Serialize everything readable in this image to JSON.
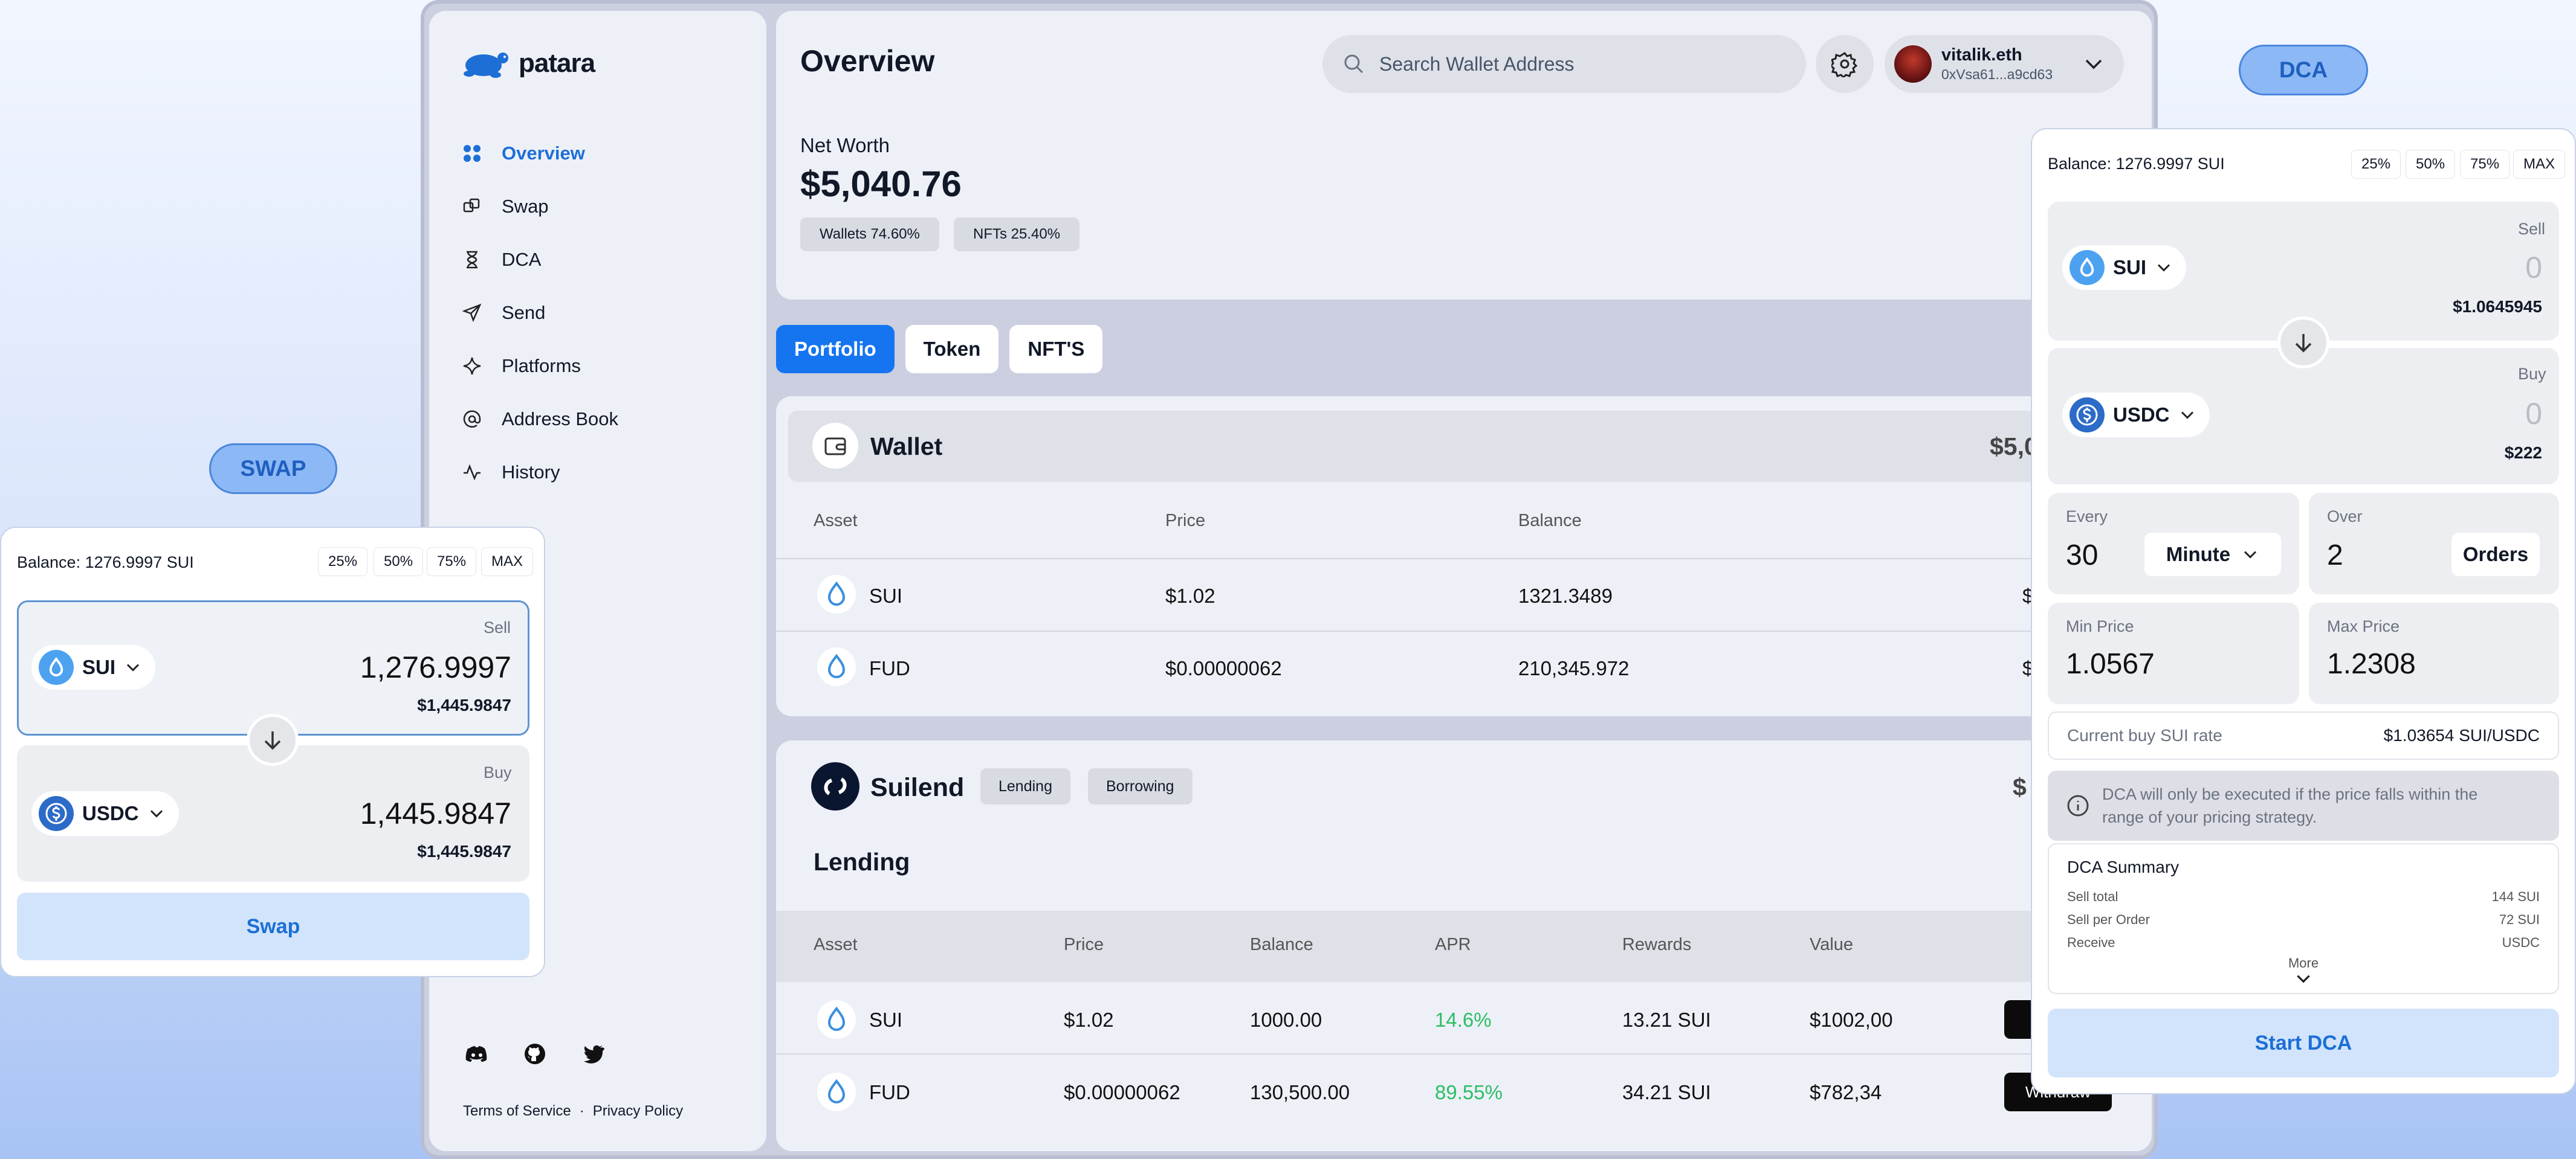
{
  "brand": {
    "name": "patara"
  },
  "sidebar": {
    "items": [
      {
        "label": "Overview",
        "icon": "grid-icon",
        "active": true
      },
      {
        "label": "Swap",
        "icon": "swap-icon"
      },
      {
        "label": "DCA",
        "icon": "hourglass-icon"
      },
      {
        "label": "Send",
        "icon": "send-icon"
      },
      {
        "label": "Platforms",
        "icon": "sparkle-icon"
      },
      {
        "label": "Address Book",
        "icon": "at-icon"
      },
      {
        "label": "History",
        "icon": "activity-icon"
      }
    ],
    "social": [
      "discord-icon",
      "github-icon",
      "twitter-icon"
    ],
    "terms": "Terms of Service",
    "separator": "·",
    "privacy": "Privacy Policy"
  },
  "header": {
    "title": "Overview",
    "search_placeholder": "Search Wallet Address",
    "user": {
      "name": "vitalik.eth",
      "address": "0xVsa61...a9cd63"
    }
  },
  "net_worth": {
    "label": "Net Worth",
    "value": "$5,040.76",
    "wallets_pill": "Wallets 74.60%",
    "nfts_pill": "NFTs 25.40%"
  },
  "tabs": [
    {
      "label": "Portfolio",
      "active": true
    },
    {
      "label": "Token"
    },
    {
      "label": "NFT'S"
    }
  ],
  "wallet": {
    "title": "Wallet",
    "total": "$5,0",
    "columns": [
      "Asset",
      "Price",
      "Balance"
    ],
    "rows": [
      {
        "asset": "SUI",
        "price": "$1.02",
        "balance": "1321.3489",
        "value": "$"
      },
      {
        "asset": "FUD",
        "price": "$0.00000062",
        "balance": "210,345.972",
        "value": "$"
      }
    ]
  },
  "suilend": {
    "title": "Suilend",
    "tags": [
      "Lending",
      "Borrowing"
    ],
    "total": "$",
    "section": "Lending",
    "columns": [
      "Asset",
      "Price",
      "Balance",
      "APR",
      "Rewards",
      "Value"
    ],
    "rows": [
      {
        "asset": "SUI",
        "price": "$1.02",
        "balance": "1000.00",
        "apr": "14.6%",
        "rewards": "13.21 SUI",
        "value": "$1002,00",
        "action": "W"
      },
      {
        "asset": "FUD",
        "price": "$0.00000062",
        "balance": "130,500.00",
        "apr": "89.55%",
        "rewards": "34.21 SUI",
        "value": "$782,34",
        "action": "Withdraw"
      }
    ]
  },
  "swap_widget": {
    "badge": "SWAP",
    "balance": "Balance: 1276.9997 SUI",
    "percent_buttons": [
      "25%",
      "50%",
      "75%",
      "MAX"
    ],
    "sell": {
      "label": "Sell",
      "token": "SUI",
      "amount": "1,276.9997",
      "usd": "$1,445.9847"
    },
    "buy": {
      "label": "Buy",
      "token": "USDC",
      "amount": "1,445.9847",
      "usd": "$1,445.9847"
    },
    "action": "Swap"
  },
  "dca_widget": {
    "badge": "DCA",
    "balance": "Balance: 1276.9997 SUI",
    "percent_buttons": [
      "25%",
      "50%",
      "75%",
      "MAX"
    ],
    "sell": {
      "label": "Sell",
      "token": "SUI",
      "amount": "0",
      "usd": "$1.0645945"
    },
    "buy": {
      "label": "Buy",
      "token": "USDC",
      "amount": "0",
      "usd": "$222"
    },
    "every": {
      "label": "Every",
      "value": "30",
      "unit": "Minute"
    },
    "over": {
      "label": "Over",
      "value": "2",
      "unit": "Orders"
    },
    "min_price": {
      "label": "Min Price",
      "value": "1.0567"
    },
    "max_price": {
      "label": "Max Price",
      "value": "1.2308"
    },
    "rate": {
      "label": "Current buy SUI rate",
      "value": "$1.03654 SUI/USDC"
    },
    "info": "DCA will only be executed if the price falls within the range of your pricing strategy.",
    "summary": {
      "title": "DCA Summary",
      "rows": [
        {
          "label": "Sell total",
          "value": "144 SUI"
        },
        {
          "label": "Sell per Order",
          "value": "72 SUI"
        },
        {
          "label": "Receive",
          "value": "USDC"
        }
      ],
      "more": "More"
    },
    "action": "Start DCA"
  },
  "colors": {
    "accent": "#1575f0",
    "positive": "#2bbf63",
    "badge": "#8cb8f5"
  }
}
